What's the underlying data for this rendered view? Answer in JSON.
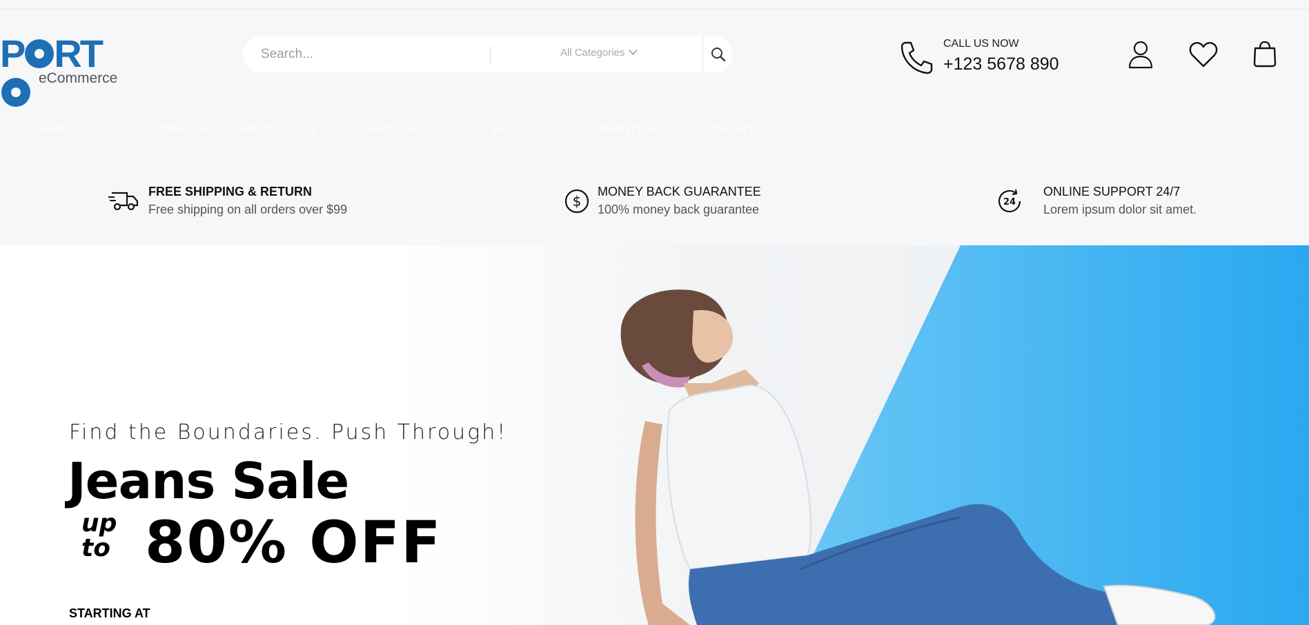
{
  "logo": {
    "brand": "PORTO",
    "brand_prefix": "P",
    "brand_suffix": "RT",
    "tagline": "eCommerce"
  },
  "search": {
    "placeholder": "Search...",
    "category": "All Categories"
  },
  "contact": {
    "label": "CALL US NOW",
    "phone": "+123 5678 890"
  },
  "header_icons": [
    "user-icon",
    "heart-icon",
    "bag-icon"
  ],
  "nav": {
    "items": [
      {
        "label": "HOME",
        "dropdown": false
      },
      {
        "label": "CATEGORIES",
        "dropdown": true
      },
      {
        "label": "PRODUCTS",
        "dropdown": true
      },
      {
        "label": "PAGES",
        "dropdown": true
      },
      {
        "label": "BLOG",
        "dropdown": false
      },
      {
        "label": "ELEMENTS",
        "dropdown": true
      },
      {
        "label": "CONTACT US",
        "dropdown": false
      }
    ]
  },
  "features": [
    {
      "icon": "truck-icon",
      "title": "FREE SHIPPING & RETURN",
      "subtitle": "Free shipping on all orders over $99"
    },
    {
      "icon": "dollar-icon",
      "title": "MONEY BACK GUARANTEE",
      "subtitle": "100% money back guarantee"
    },
    {
      "icon": "support-24-icon",
      "title": "ONLINE SUPPORT 24/7",
      "subtitle": "Lorem ipsum dolor sit amet."
    }
  ],
  "hero": {
    "subtitle": "Find the Boundaries. Push Through!",
    "title": "Jeans Sale",
    "up": "up",
    "to": "to",
    "discount": "80% OFF",
    "starting": "STARTING AT"
  },
  "colors": {
    "brand": "#1e6fb5",
    "hero_blue": "#2aa8f0",
    "page_bg": "#f6f7f9"
  }
}
